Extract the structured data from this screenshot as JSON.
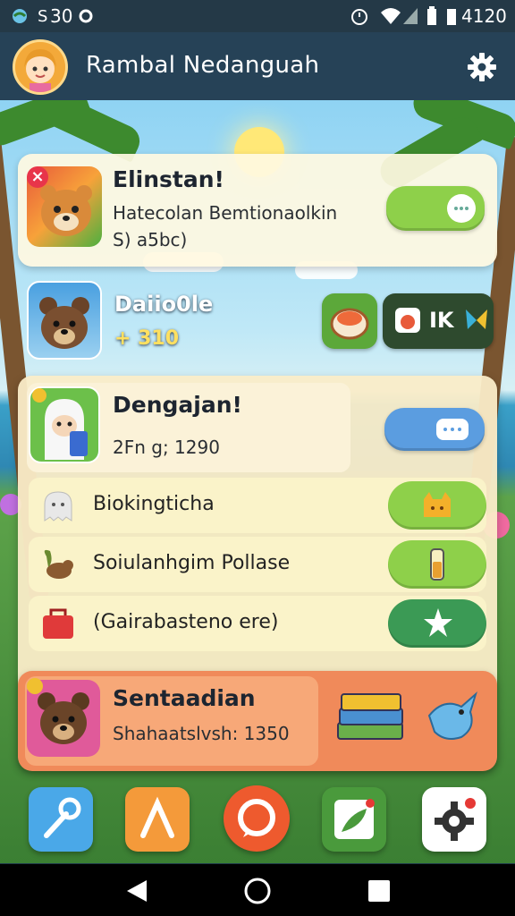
{
  "status": {
    "left_text": "30",
    "time": "4120"
  },
  "header": {
    "title": "Rambal Nedanguah",
    "settings_icon": "gear-icon"
  },
  "card1": {
    "title": "Elinstan!",
    "line1": "Hatecolan Bemtionaolkin",
    "line2": "S) a5bc)",
    "badge": "×",
    "toggle_color": "#8ed04a"
  },
  "row2": {
    "name": "Daiio0le",
    "score": "+ 310",
    "badge_text": "IK"
  },
  "card3": {
    "title": "Dengajan!",
    "subtitle": "2Fn g; 1290",
    "toggle_color": "#5b9de0"
  },
  "list": [
    {
      "label": "Biokingticha",
      "icon": "ghost-icon",
      "pill_color": "#8ed04a"
    },
    {
      "label": "Soiulanhgim Pollase",
      "icon": "squirrel-icon",
      "pill_color": "#8ed04a"
    },
    {
      "label": "(Gairabasteno ere)",
      "icon": "bag-icon",
      "pill_color": "#3b9a55"
    }
  ],
  "featured": {
    "title": "Sentaadian",
    "subtitle": "Shahaatslvsh: 1350"
  },
  "dock": [
    {
      "name": "tools",
      "color": "#4aa8e8"
    },
    {
      "name": "map",
      "color": "#f49a3a"
    },
    {
      "name": "chat",
      "color": "#ee5a2e"
    },
    {
      "name": "messages",
      "color": "#4a9a3c"
    },
    {
      "name": "settings",
      "color": "#ffffff"
    }
  ]
}
